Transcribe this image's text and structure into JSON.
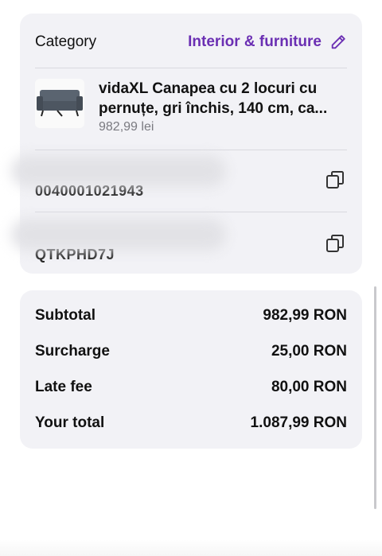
{
  "category": {
    "label": "Category",
    "value": "Interior & furniture"
  },
  "product": {
    "title_line1": "vidaXL Canapea cu 2 locuri cu",
    "title_line2": "pernuțe, gri închis, 140 cm, ca...",
    "price": "982,99 lei"
  },
  "codes": [
    {
      "value": "0040001021943"
    },
    {
      "value": "QTKPHD7J"
    }
  ],
  "summary": {
    "rows": [
      {
        "label": "Subtotal",
        "value": "982,99 RON"
      },
      {
        "label": "Surcharge",
        "value": "25,00 RON"
      },
      {
        "label": "Late fee",
        "value": "80,00 RON"
      }
    ],
    "total": {
      "label": "Your total",
      "value": "1.087,99 RON"
    }
  },
  "colors": {
    "accent": "#6b2fb3",
    "card_bg": "#f2f2f6"
  }
}
